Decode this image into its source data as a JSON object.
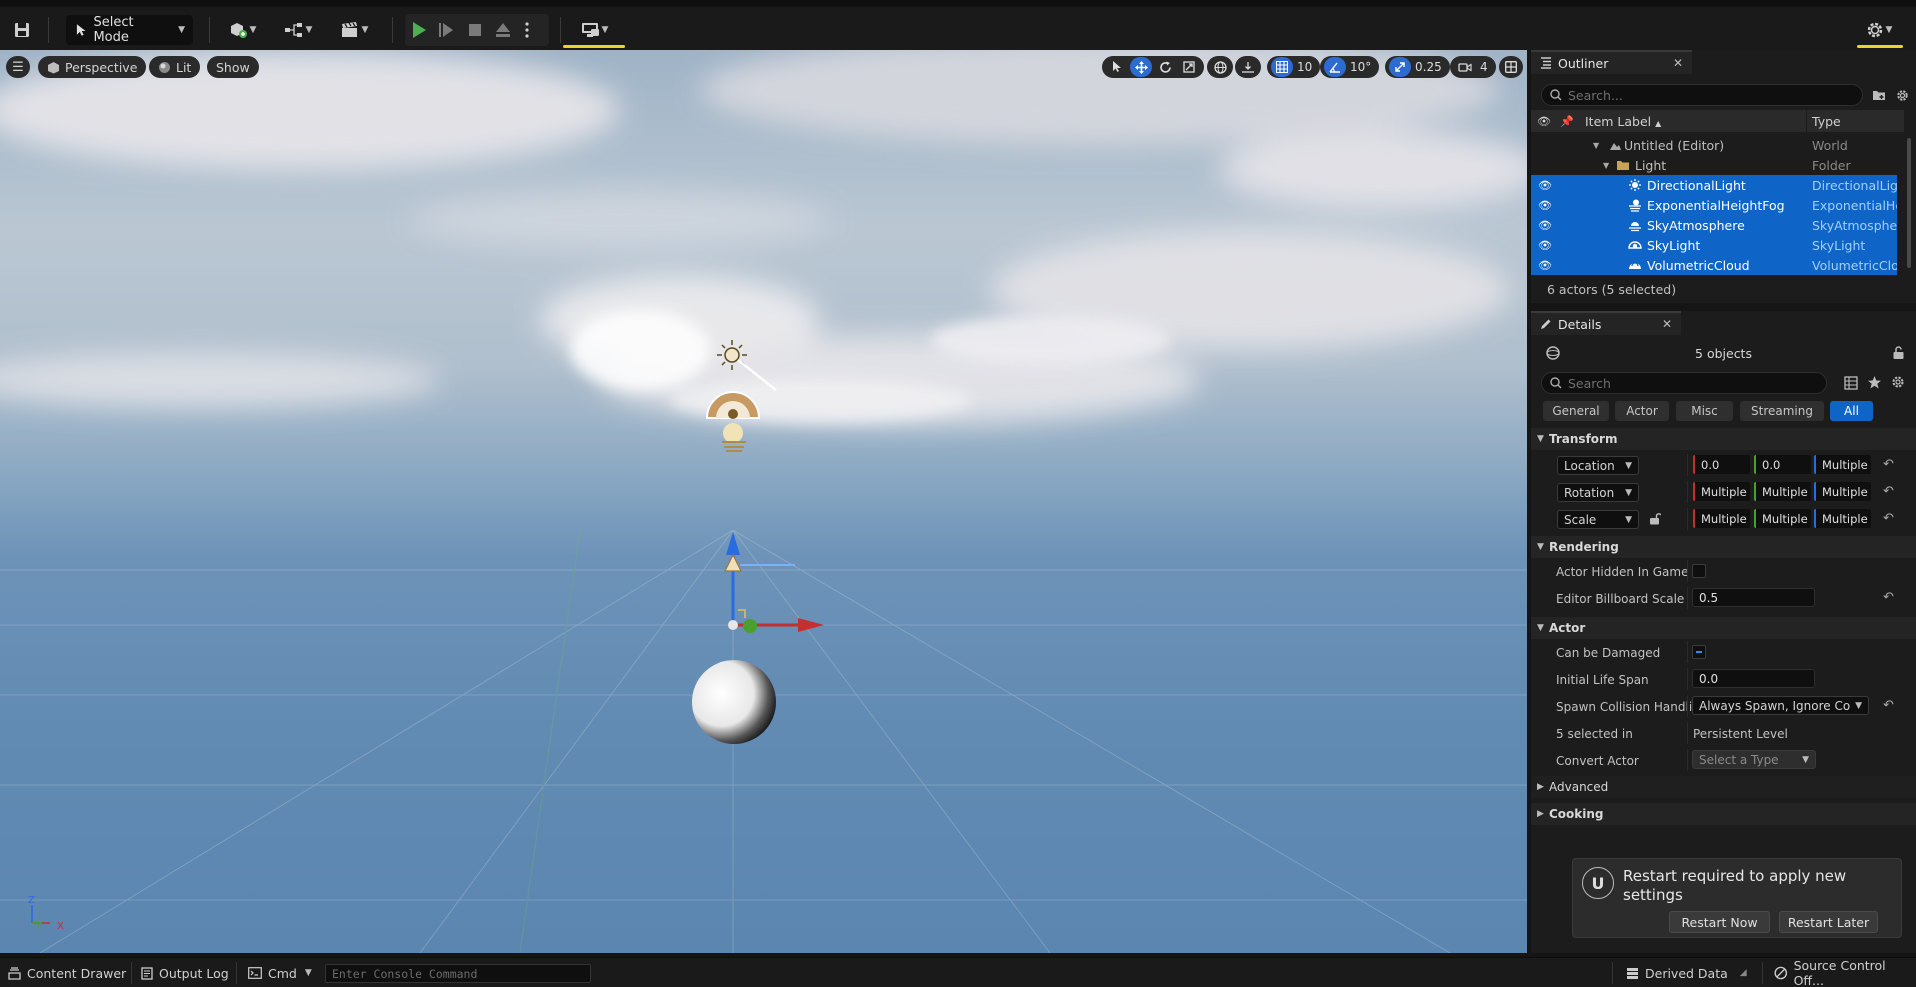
{
  "toolbar": {
    "select_mode_label": "Select Mode",
    "accent_color": "#f2d12a",
    "play_color": "#4caf50"
  },
  "viewport": {
    "perspective_label": "Perspective",
    "lit_label": "Lit",
    "show_label": "Show",
    "grid_snap_value": "10",
    "rotation_snap_value": "10°",
    "scale_snap_value": "0.25",
    "camera_speed_value": "4",
    "axis_x": "X",
    "axis_y": "Y",
    "axis_z": "Z"
  },
  "outliner": {
    "tab_label": "Outliner",
    "search_placeholder": "Search...",
    "col_label": "Item Label",
    "col_type": "Type",
    "rows": [
      {
        "label": "Untitled (Editor)",
        "type": "World",
        "selected": false,
        "icon": "world-icon"
      },
      {
        "label": "Light",
        "type": "Folder",
        "selected": false,
        "icon": "folder-icon"
      },
      {
        "label": "DirectionalLight",
        "type": "DirectionalLight",
        "selected": true,
        "icon": "directional-light-icon"
      },
      {
        "label": "ExponentialHeightFog",
        "type": "ExponentialHeightFog",
        "selected": true,
        "icon": "fog-icon"
      },
      {
        "label": "SkyAtmosphere",
        "type": "SkyAtmosphere",
        "selected": true,
        "icon": "sky-atmosphere-icon"
      },
      {
        "label": "SkyLight",
        "type": "SkyLight",
        "selected": true,
        "icon": "sky-light-icon"
      },
      {
        "label": "VolumetricCloud",
        "type": "VolumetricCloud",
        "selected": true,
        "icon": "cloud-icon"
      }
    ],
    "footer": "6 actors (5 selected)"
  },
  "details": {
    "tab_label": "Details",
    "object_count": "5 objects",
    "search_placeholder": "Search",
    "filters": [
      "General",
      "Actor",
      "Misc",
      "Streaming",
      "All"
    ],
    "active_filter": "All",
    "transform": {
      "section": "Transform",
      "location_label": "Location",
      "location": [
        "0.0",
        "0.0",
        "Multiple"
      ],
      "rotation_label": "Rotation",
      "rotation": [
        "Multiple",
        "Multiple",
        "Multiple"
      ],
      "scale_label": "Scale",
      "scale": [
        "Multiple",
        "Multiple",
        "Multiple"
      ]
    },
    "rendering": {
      "section": "Rendering",
      "hidden_label": "Actor Hidden In Game",
      "billboard_label": "Editor Billboard Scale",
      "billboard_value": "0.5"
    },
    "actor": {
      "section": "Actor",
      "damaged_label": "Can be Damaged",
      "lifespan_label": "Initial Life Span",
      "lifespan_value": "0.0",
      "spawn_label": "Spawn Collision Handli...",
      "spawn_value": "Always Spawn, Ignore Collisi",
      "selected_in_label": "5 selected in",
      "selected_in_value": "Persistent Level",
      "convert_label": "Convert Actor",
      "convert_value": "Select a Type"
    },
    "advanced_section": "Advanced",
    "cooking_section": "Cooking"
  },
  "toast": {
    "message": "Restart required to apply new settings",
    "restart_now": "Restart Now",
    "restart_later": "Restart Later"
  },
  "statusbar": {
    "content_drawer": "Content Drawer",
    "output_log": "Output Log",
    "cmd": "Cmd",
    "console_placeholder": "Enter Console Command",
    "derived_data": "Derived Data",
    "source_control": "Source Control Off..."
  }
}
